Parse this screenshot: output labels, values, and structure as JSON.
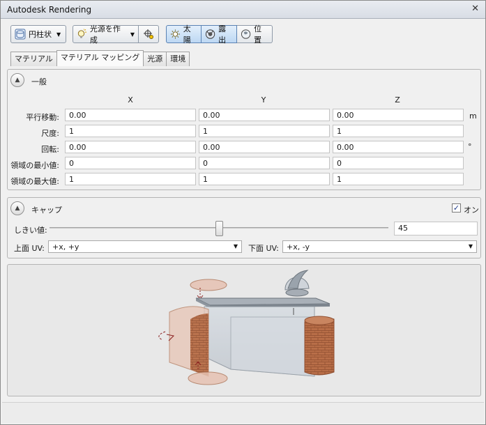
{
  "window": {
    "title": "Autodesk Rendering",
    "close_glyph": "✕"
  },
  "toolbar": {
    "mapping_button": {
      "label": "円柱状",
      "icon": "cylinder-map-icon"
    },
    "light_button": {
      "label": "光源を作成",
      "icon": "light-bulb-icon"
    },
    "locate_icon": "crosshair-pin-icon",
    "sun": {
      "label": "太陽",
      "icon": "sun-icon"
    },
    "exposure": {
      "label": "露出",
      "icon": "exposure-icon"
    },
    "position": {
      "label": "位置",
      "icon": "globe-icon"
    }
  },
  "tabs": [
    {
      "label": "マテリアル"
    },
    {
      "label": "マテリアル マッピング",
      "active": true
    },
    {
      "label": "光源"
    },
    {
      "label": "環境"
    }
  ],
  "general": {
    "title": "一般",
    "columns": [
      "X",
      "Y",
      "Z"
    ],
    "rows": [
      {
        "label": "平行移動:",
        "values": [
          "0.00",
          "0.00",
          "0.00"
        ],
        "unit": "m"
      },
      {
        "label": "尺度:",
        "values": [
          "1",
          "1",
          "1"
        ],
        "unit": ""
      },
      {
        "label": "回転:",
        "values": [
          "0.00",
          "0.00",
          "0.00"
        ],
        "unit": "°"
      },
      {
        "label": "領域の最小値:",
        "values": [
          "0",
          "0",
          "0"
        ],
        "unit": ""
      },
      {
        "label": "領域の最大値:",
        "values": [
          "1",
          "1",
          "1"
        ],
        "unit": ""
      }
    ]
  },
  "cap": {
    "title": "キャップ",
    "on_label": "オン",
    "on_checked": true,
    "threshold_label": "しきい値:",
    "threshold_value": "45",
    "threshold_fraction": 0.5,
    "top_uv_label": "上面 UV:",
    "top_uv_value": "+x, +y",
    "bottom_uv_label": "下面 UV:",
    "bottom_uv_value": "+x, -y"
  },
  "colors": {
    "accent": "#5a82b3",
    "brick": "#b8704c",
    "glass": "#c9cfd6"
  }
}
